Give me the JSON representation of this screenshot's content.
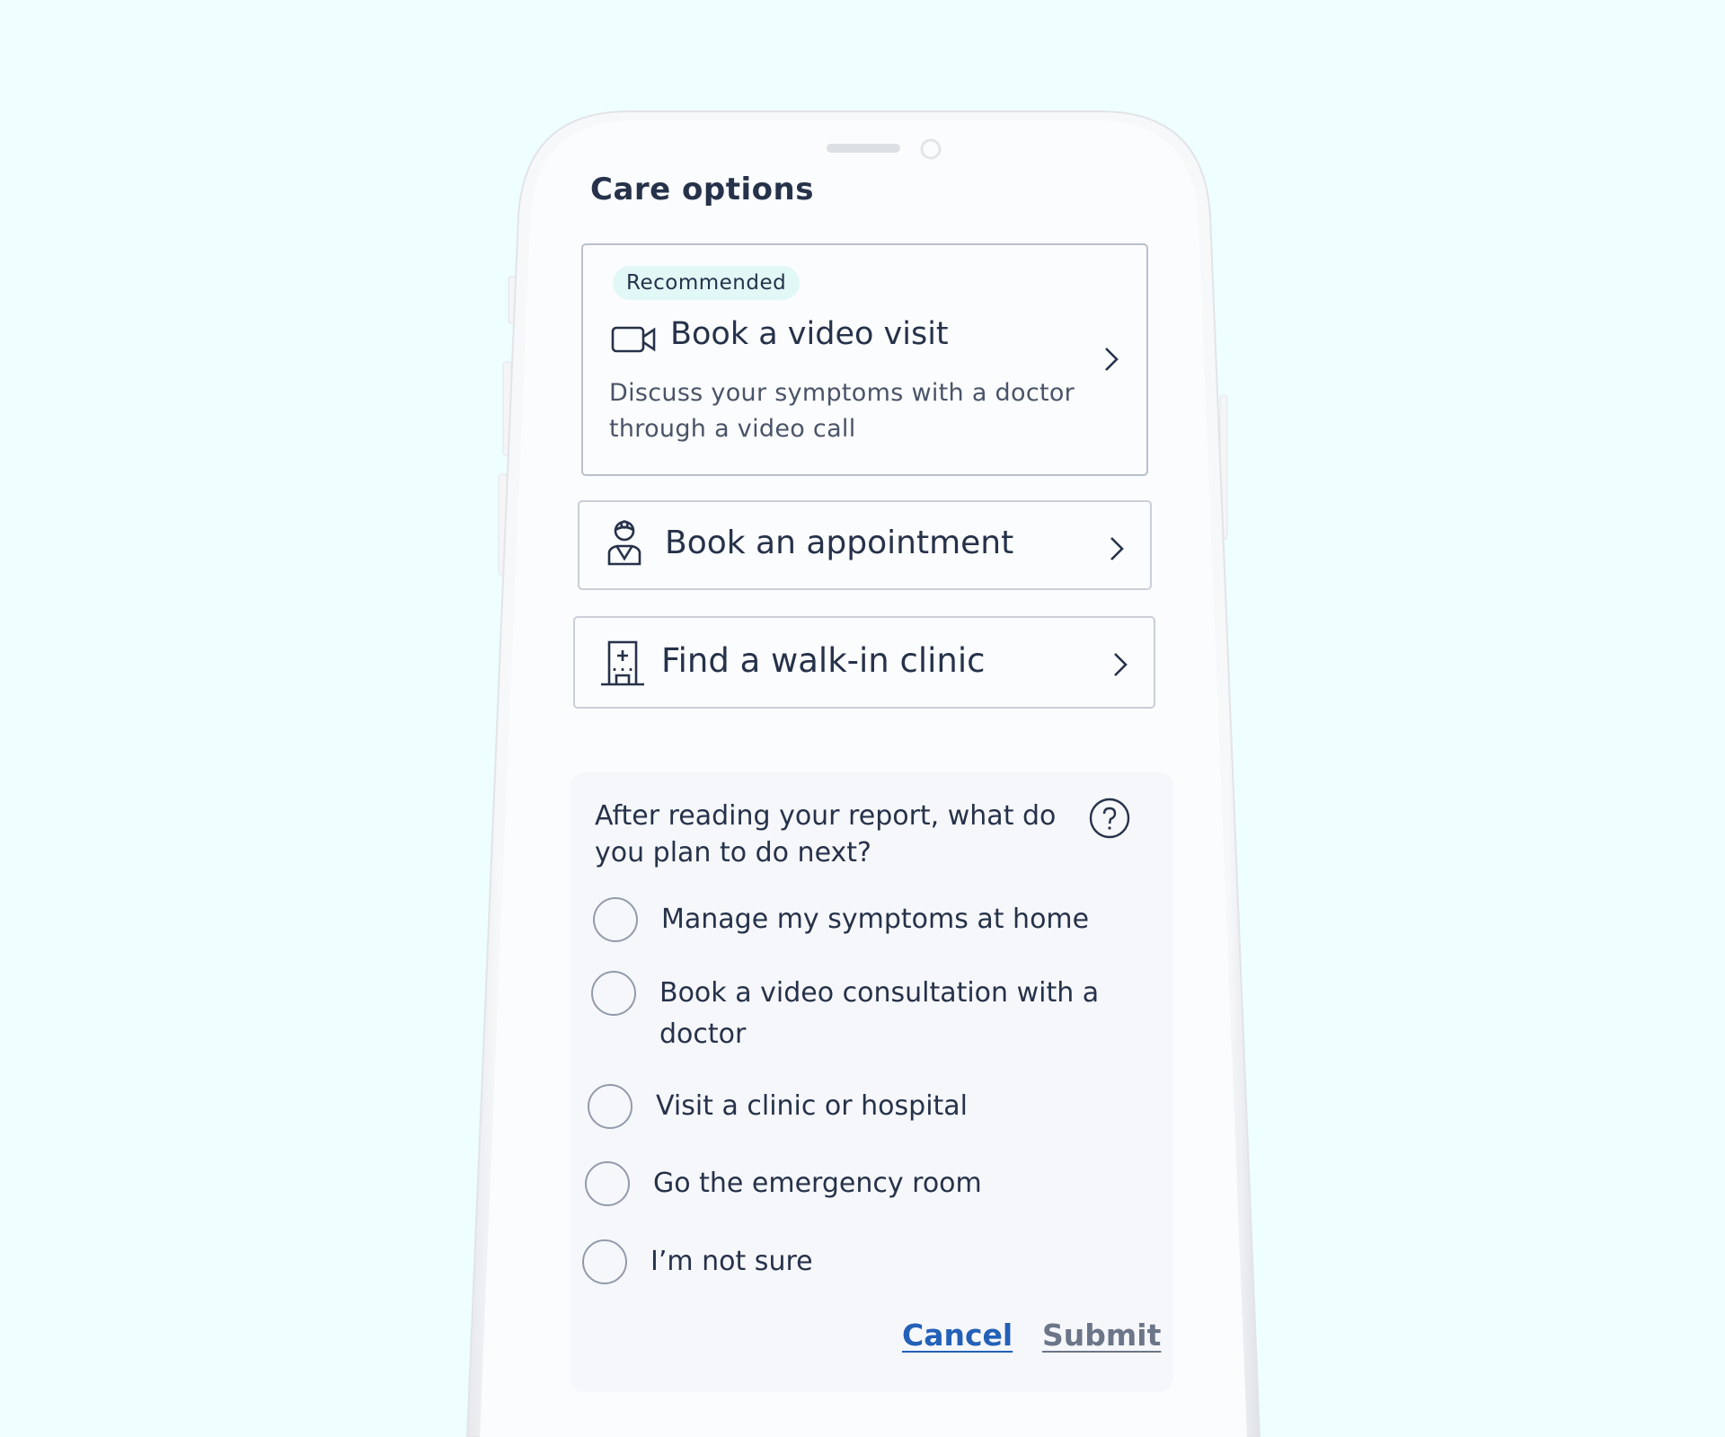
{
  "colors": {
    "background": "#effefe",
    "phone_body": "#fafbfc",
    "text_primary": "#26324a",
    "badge_bg": "#e2f8f7",
    "panel_bg": "#f6f7fa",
    "link_primary": "#2360b8",
    "link_disabled": "#6c7689"
  },
  "screen": {
    "title": "Care options"
  },
  "care_options": [
    {
      "badge": "Recommended",
      "icon": "video-camera-icon",
      "label": "Book a video visit",
      "description": "Discuss your symptoms with a doctor through a video call"
    },
    {
      "icon": "doctor-icon",
      "label": "Book an appointment"
    },
    {
      "icon": "clinic-building-icon",
      "label": "Find a walk-in clinic"
    }
  ],
  "survey": {
    "question": "After reading your report, what do you plan to do next?",
    "help_icon": "question-circle-icon",
    "options": [
      {
        "label": "Manage my symptoms at home",
        "selected": false
      },
      {
        "label": "Book a video consultation with a doctor",
        "selected": false
      },
      {
        "label": "Visit a clinic or hospital",
        "selected": false
      },
      {
        "label": "Go the emergency room",
        "selected": false
      },
      {
        "label": "I’m not sure",
        "selected": false
      }
    ],
    "cancel_label": "Cancel",
    "submit_label": "Submit"
  }
}
